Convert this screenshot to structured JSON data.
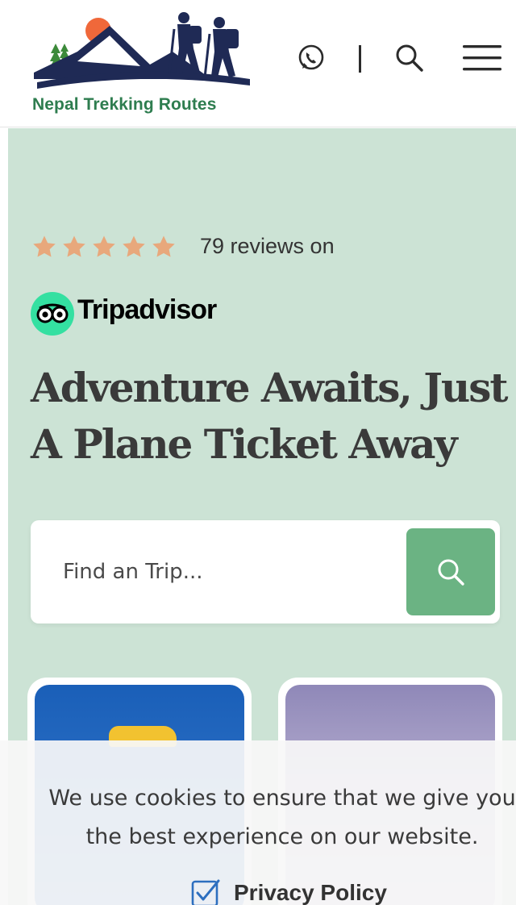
{
  "header": {
    "brand_name": "Nepal Trekking Routes",
    "icons": [
      "whatsapp-icon",
      "search-icon",
      "hamburger-menu-icon"
    ]
  },
  "hero": {
    "rating_stars": 5,
    "reviews_text": "79 reviews on",
    "platform": "Tripadvisor",
    "headline_line1": "Adventure Awaits, Just",
    "headline_line2": "A Plane Ticket Away",
    "search": {
      "placeholder": "Find an Trip..."
    }
  },
  "cookie_banner": {
    "line1": "We use cookies to ensure that we give you",
    "line2": "the best experience on our website.",
    "privacy_label": "Privacy Policy"
  },
  "colors": {
    "hero_bg": "#cce3d5",
    "brand_green": "#2e7d4f",
    "search_button": "#6bb383",
    "star": "#e8a87c",
    "tripadvisor_green": "#34e0a1",
    "heading_text": "#3a3a3a"
  }
}
